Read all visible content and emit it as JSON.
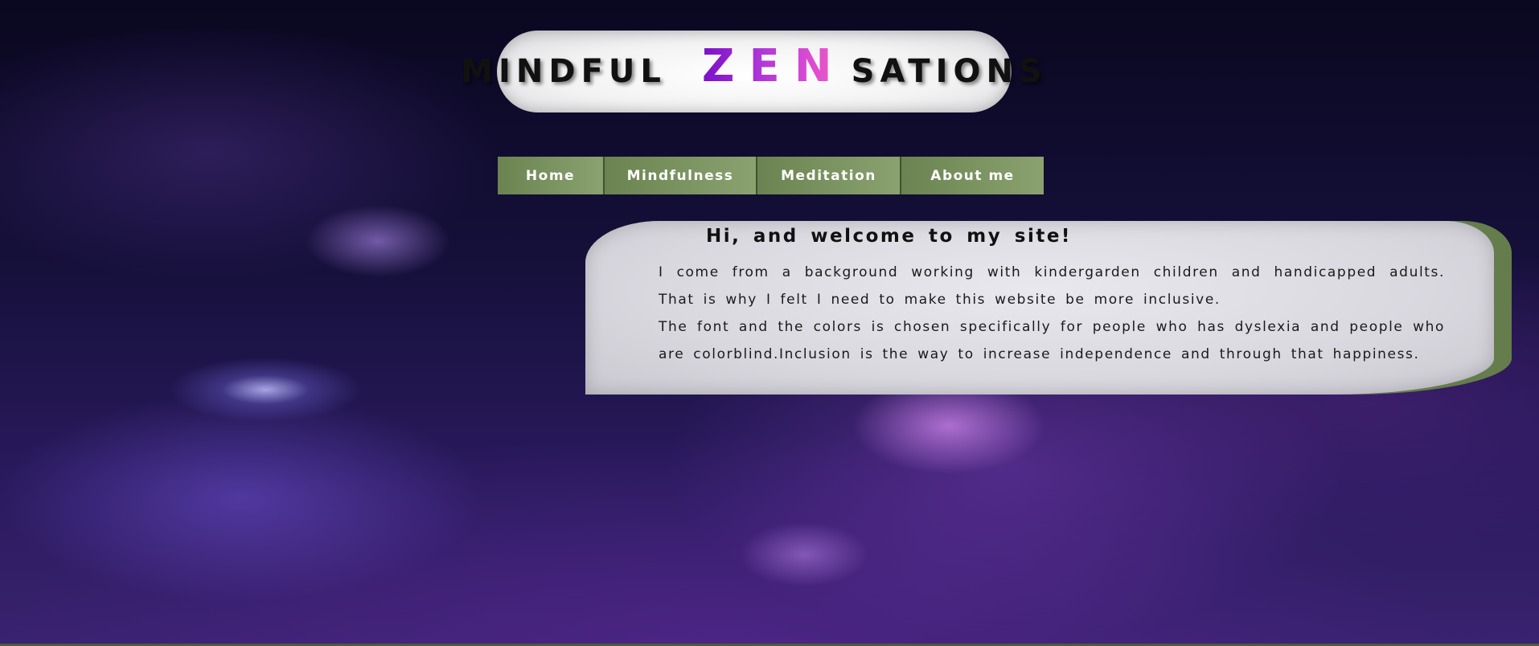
{
  "site": {
    "title_left": "MINDFUL",
    "title_highlight": "ZEN",
    "title_right": "SATIONS"
  },
  "nav": {
    "items": [
      {
        "label": "Home"
      },
      {
        "label": "Mindfulness"
      },
      {
        "label": "Meditation"
      },
      {
        "label": "About me"
      }
    ]
  },
  "welcome": {
    "heading": "Hi, and welcome to my site!",
    "paragraph1": "I come from a background working with kindergarden children and handicapped adults. That is why I felt I need to make this website be more inclusive.",
    "paragraph2": "The font and the colors is chosen specifically for people who has dyslexia and people who are colorblind.Inclusion is the way to increase independence and through that happiness."
  },
  "colors": {
    "nav_green": "#6a8351",
    "card_green_edge": "#657d4c",
    "zen_gradient_start": "#7a10c8",
    "zen_gradient_end": "#f060b0",
    "card_background": "#d9d8df"
  }
}
